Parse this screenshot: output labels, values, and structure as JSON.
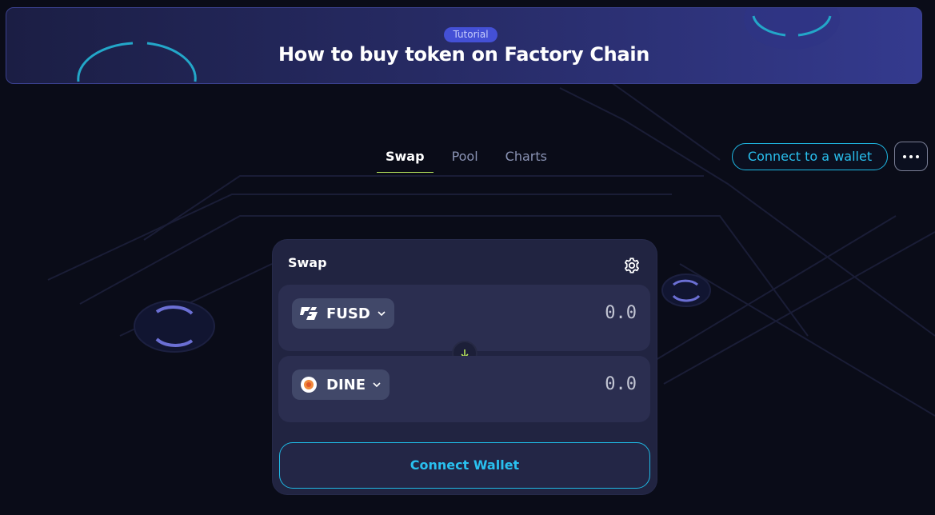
{
  "banner": {
    "badge": "Tutorial",
    "title": "How to buy token on Factory Chain"
  },
  "nav": {
    "tabs": [
      {
        "label": "Swap",
        "active": true
      },
      {
        "label": "Pool",
        "active": false
      },
      {
        "label": "Charts",
        "active": false
      }
    ],
    "connect_label": "Connect to a wallet"
  },
  "swap": {
    "title": "Swap",
    "from": {
      "token": "FUSD",
      "amount": "0.0"
    },
    "to": {
      "token": "DINE",
      "amount": "0.0"
    },
    "connect_button": "Connect Wallet"
  },
  "icons": {
    "settings": "gear-icon",
    "more": "more-dots-icon",
    "swap_direction": "arrow-down-icon",
    "dropdown": "chevron-down-icon"
  },
  "colors": {
    "accent": "#1fb9e4",
    "active_tab_underline": "#b8e65c",
    "background": "#0a0c18",
    "card": "#212441"
  }
}
